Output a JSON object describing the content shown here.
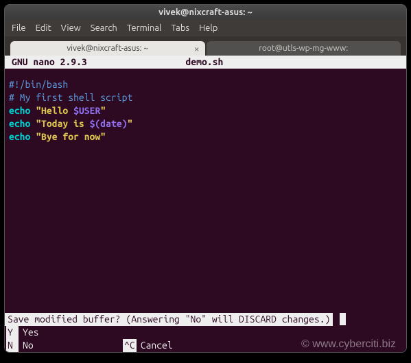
{
  "window": {
    "title": "vivek@nixcraft-asus: ~"
  },
  "menubar": {
    "file": "File",
    "edit": "Edit",
    "view": "View",
    "search": "Search",
    "terminal": "Terminal",
    "tabs": "Tabs",
    "help": "Help"
  },
  "tabs": {
    "active": "vivek@nixcraft-asus: ~",
    "inactive": "root@utls-wp-mg-www:"
  },
  "nano": {
    "app": "GNU nano 2.9.3",
    "filename": "demo.sh"
  },
  "script": {
    "l1": "#!/bin/bash",
    "l2": "# My first shell script",
    "l3a": "echo",
    "l3b": " \"Hello ",
    "l3c": "$USER",
    "l3d": "\"",
    "l4a": "echo",
    "l4b": " \"Today is ",
    "l4c": "$(date)",
    "l4d": "\"",
    "l5a": "echo",
    "l5b": " \"Bye for now\""
  },
  "footer": {
    "prompt": "Save modified buffer?  (Answering \"No\" will DISCARD changes.)",
    "yes_key": " Y",
    "yes_label": "Yes",
    "no_key": " N",
    "no_label": "No",
    "cancel_key": "^C",
    "cancel_label": "Cancel"
  },
  "watermark": "© www.cyberciti.biz"
}
